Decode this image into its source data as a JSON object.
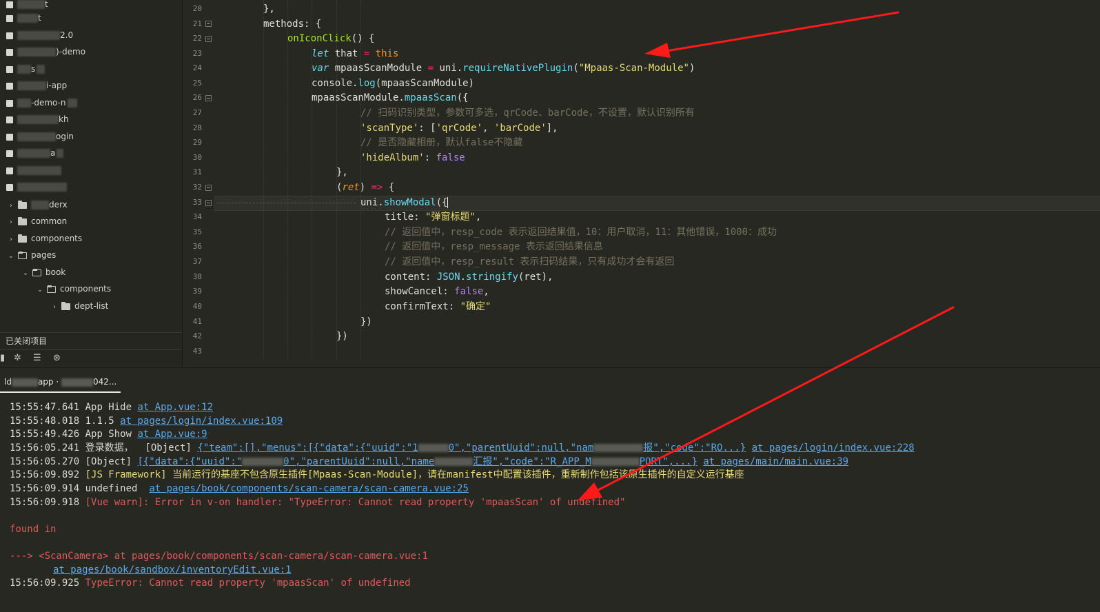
{
  "sidebar": {
    "items": [
      {
        "label": "t"
      },
      {
        "label": "2.0"
      },
      {
        "label": ")-demo"
      },
      {
        "label": "s"
      },
      {
        "label": "i-app"
      },
      {
        "label": "-demo-n"
      },
      {
        "label": "kh"
      },
      {
        "label": "ogin"
      },
      {
        "label": "a"
      },
      {
        "label": ""
      },
      {
        "label": ""
      }
    ],
    "tree": [
      {
        "label": "derx",
        "caret": "›"
      },
      {
        "label": "common",
        "caret": "›"
      },
      {
        "label": "components",
        "caret": "›"
      },
      {
        "label": "pages",
        "caret": "⌄"
      },
      {
        "label": "book",
        "caret": "⌄"
      },
      {
        "label": "components",
        "caret": "⌄"
      },
      {
        "label": "dept-list",
        "caret": "›"
      }
    ],
    "closed_projects": "已关闭项目"
  },
  "editor": {
    "line_numbers": [
      "20",
      "21",
      "22",
      "23",
      "24",
      "25",
      "26",
      "27",
      "28",
      "29",
      "30",
      "31",
      "32",
      "33",
      "34",
      "35",
      "36",
      "37",
      "38",
      "39",
      "40",
      "41",
      "42",
      "43"
    ],
    "code": {
      "l20": "},",
      "l21_a": "methods",
      "l21_b": ": {",
      "l22_fn": "onIconClick",
      "l22_rest": "() {",
      "l23_let": "let",
      "l23_mid": " that ",
      "l23_eq": "=",
      "l23_this": " this",
      "l24_var": "var",
      "l24_mid": " mpaasScanModule ",
      "l24_eq": "=",
      "l24_uni": " uni.",
      "l24_fn": "requireNativePlugin",
      "l24_open": "(",
      "l24_str": "\"Mpaas-Scan-Module\"",
      "l24_close": ")",
      "l25_a": "console.",
      "l25_fn": "log",
      "l25_rest": "(mpaasScanModule)",
      "l26_a": "mpaasScanModule.",
      "l26_fn": "mpaasScan",
      "l26_rest": "({",
      "l27": "// 扫码识别类型，参数可多选，qrCode、barCode，不设置，默认识别所有",
      "l28_key": "'scanType'",
      "l28_colon": ": [",
      "l28_v1": "'qrCode'",
      "l28_comma": ", ",
      "l28_v2": "'barCode'",
      "l28_end": "],",
      "l29": "// 是否隐藏相册，默认false不隐藏",
      "l30_key": "'hideAlbum'",
      "l30_colon": ": ",
      "l30_val": "false",
      "l31": "},",
      "l32_open": "(",
      "l32_par": "ret",
      "l32_close": ") ",
      "l32_arrow": "=>",
      "l32_end": " {",
      "l33_a": "uni.",
      "l33_fn": "showModal",
      "l33_rest": "({",
      "l34_key": "title: ",
      "l34_val": "\"弹窗标题\"",
      "l34_end": ",",
      "l35": "// 返回值中，resp_code 表示返回结果值，10：用户取消，11：其他错误，1000：成功",
      "l36": "// 返回值中，resp_message 表示返回结果信息",
      "l37": "// 返回值中，resp_result 表示扫码结果，只有成功才会有返回",
      "l38_key": "content: ",
      "l38_json": "JSON",
      "l38_dot": ".",
      "l38_fn": "stringify",
      "l38_rest": "(ret),",
      "l39_key": "showCancel: ",
      "l39_val": "false",
      "l39_end": ",",
      "l40_key": "confirmText: ",
      "l40_val": "\"确定\"",
      "l41": "})",
      "l42": "})"
    }
  },
  "console": {
    "tab_label_a": "ld",
    "tab_label_b": "app ·",
    "tab_label_c": "042...",
    "logs": [
      {
        "time": "15:55:47.641",
        "text": "App Hide ",
        "link": "at App.vue:12"
      },
      {
        "time": "15:55:48.018",
        "text": "1.1.5 ",
        "link": "at pages/login/index.vue:109"
      },
      {
        "time": "15:55:49.426",
        "text": "App Show ",
        "link": "at App.vue:9"
      },
      {
        "time": "15:56:05.241",
        "text": "登录数据，  [Object] ",
        "link_a": "{\"team\":[],\"menus\":[{\"data\":{\"uuid\":\"1",
        "link_b": "0\",\"parentUuid\":null,\"nam",
        "link_c": "报\",\"code\":\"RO...}",
        "link_d": "at pages/login/index.vue:228"
      },
      {
        "time": "15:56:05.270",
        "text": "[Object] ",
        "link_a": "[{\"data\":{\"uuid\":\"",
        "link_b": "0\",\"parentUuid\":null,\"name",
        "link_c": "汇报\",\"code\":\"R",
        "link_d": "_APP_M",
        "link_e": "PORT\",...}",
        "link_f": "at pages/main/main.vue:39"
      },
      {
        "time": "15:56:09.892",
        "text": "[JS Framework] 当前运行的基座不包含原生插件[Mpaas-Scan-Module]，请在manifest中配置该插件，重新制作包括该原生插件的自定义运行基座"
      },
      {
        "time": "15:56:09.914",
        "text": "undefined  ",
        "link": "at pages/book/components/scan-camera/scan-camera.vue:25"
      },
      {
        "time": "15:56:09.918",
        "text": "[Vue warn]: Error in v-on handler: \"TypeError: Cannot read property 'mpaasScan' of undefined\""
      },
      {
        "time": "",
        "text": "found in"
      },
      {
        "time": "",
        "text": "---> <ScanCamera> at pages/book/components/scan-camera/scan-camera.vue:1"
      },
      {
        "time": "",
        "text": "",
        "link": "at pages/book/sandbox/inventoryEdit.vue:1"
      },
      {
        "time": "15:56:09.925",
        "text": "TypeError: Cannot read property 'mpaasScan' of undefined"
      }
    ]
  },
  "colors": {
    "background": "#272822",
    "keyword": "#f92672",
    "function": "#a6e22e",
    "string": "#e6db74",
    "boolean": "#ae81ff",
    "comment": "#75715e",
    "link": "#5aa8ea",
    "error": "#f06060",
    "arrow": "#ff1a1a"
  },
  "icons": [
    "project-icon",
    "caret-right-icon",
    "caret-down-icon",
    "folder-icon",
    "folder-open-icon",
    "debug-bug-icon",
    "search-log-icon",
    "network-icon"
  ]
}
